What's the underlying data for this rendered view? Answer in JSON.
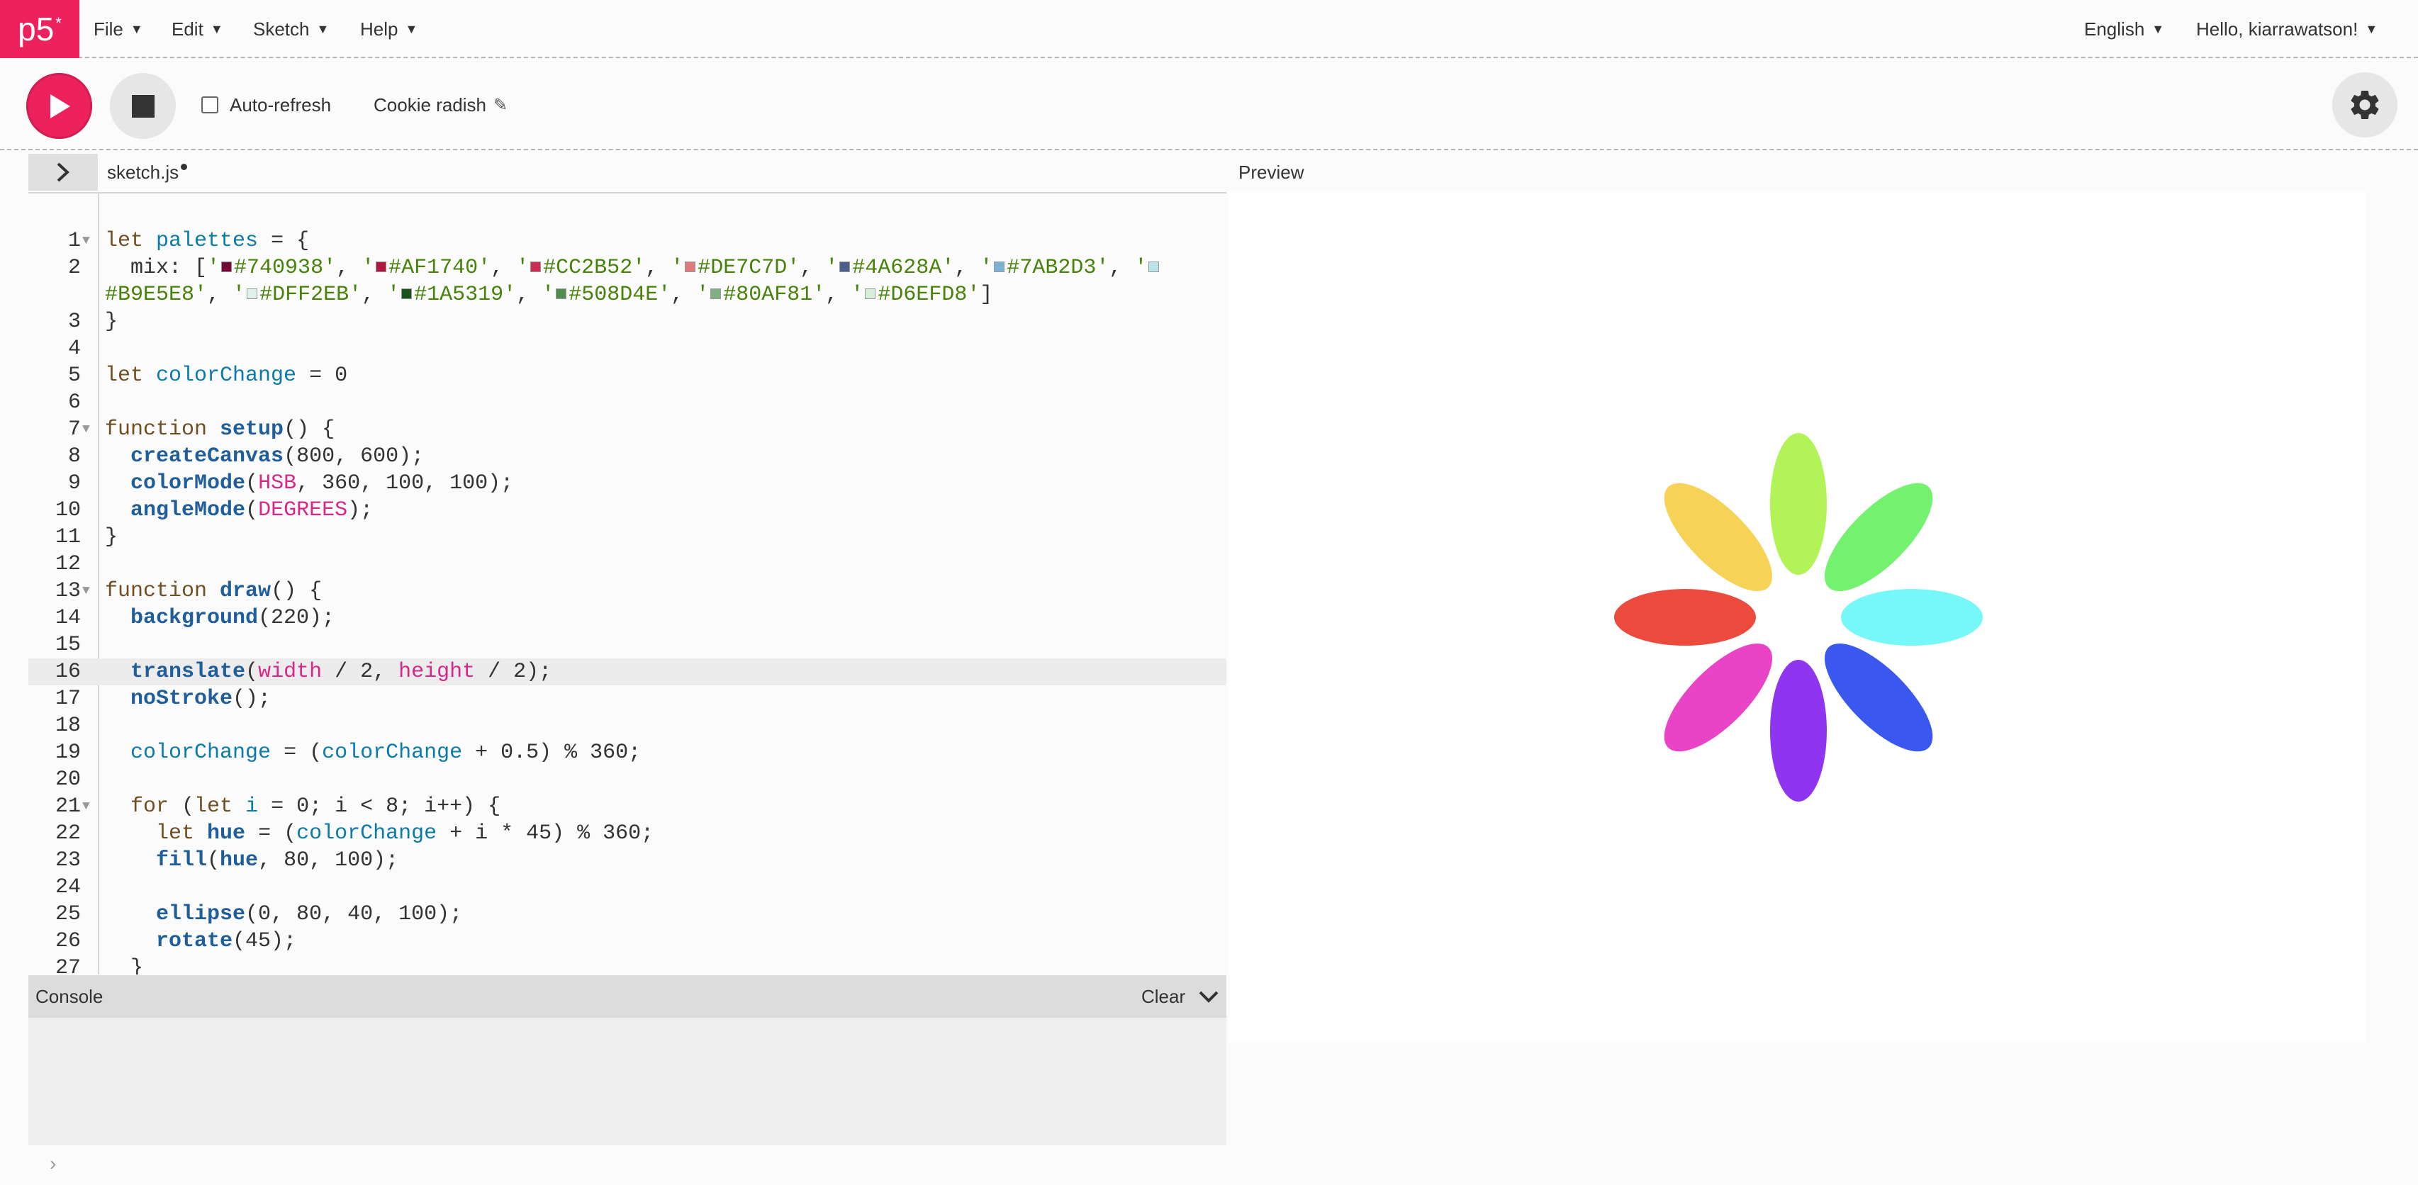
{
  "app": {
    "logo_text": "p5",
    "logo_sup": "*",
    "brand_color": "#ed225d"
  },
  "nav": {
    "menus": [
      {
        "label": "File"
      },
      {
        "label": "Edit"
      },
      {
        "label": "Sketch"
      },
      {
        "label": "Help"
      }
    ],
    "language": "English",
    "user_greeting": "Hello, kiarrawatson!"
  },
  "toolbar": {
    "auto_refresh_label": "Auto-refresh",
    "auto_refresh_checked": false,
    "sketch_name": "Cookie radish"
  },
  "editor": {
    "file_tab": "sketch.js",
    "unsaved": true,
    "active_line": 16
  },
  "preview": {
    "label": "Preview"
  },
  "console": {
    "title": "Console",
    "clear_label": "Clear"
  },
  "canvas": {
    "ellipse_colors": [
      "#eb4a3d",
      "#f6d257",
      "#b2f358",
      "#74f26f",
      "#76f8f8",
      "#3a58f0",
      "#9035ef",
      "#ea44c6"
    ]
  }
}
